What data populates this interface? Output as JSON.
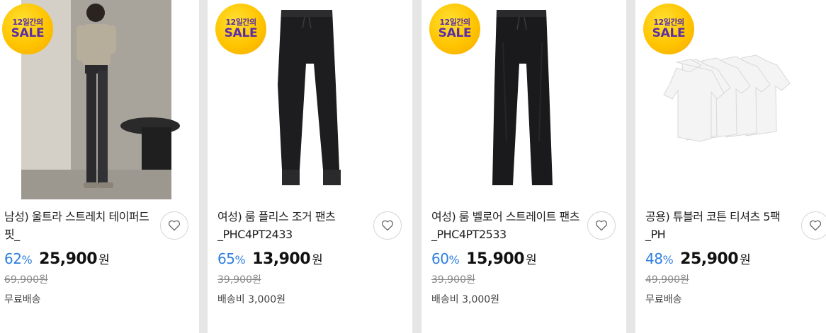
{
  "badge": {
    "line1": "12일간의",
    "line2": "SALE"
  },
  "colors": {
    "discount": "#2f7fe0",
    "badge_bg": "#ffc400",
    "badge_text": "#5a2ea6",
    "background": "#e6e6e6"
  },
  "products": [
    {
      "title": "남성) 울트라 스트레치 테이퍼드 핏_",
      "discount": "62",
      "discount_symbol": "%",
      "price": "25,900",
      "currency": "원",
      "original_price": "69,900원",
      "shipping": "무료배송",
      "image": "man-in-beige-tshirt-and-black-pants"
    },
    {
      "title": "여성) 룸 플리스 조거 팬츠_PHC4PT2433",
      "discount": "65",
      "discount_symbol": "%",
      "price": "13,900",
      "currency": "원",
      "original_price": "39,900원",
      "shipping": "배송비 3,000원",
      "image": "black-fleece-jogger-pants"
    },
    {
      "title": "여성) 룸 벨로어 스트레이트 팬츠_PHC4PT2533",
      "discount": "60",
      "discount_symbol": "%",
      "price": "15,900",
      "currency": "원",
      "original_price": "39,900원",
      "shipping": "배송비 3,000원",
      "image": "black-velour-straight-pants"
    },
    {
      "title": "공용) 튜블러 코튼 티셔츠 5팩_PH",
      "discount": "48",
      "discount_symbol": "%",
      "price": "25,900",
      "currency": "원",
      "original_price": "49,900원",
      "shipping": "무료배송",
      "image": "white-tshirt-5-pack"
    }
  ]
}
